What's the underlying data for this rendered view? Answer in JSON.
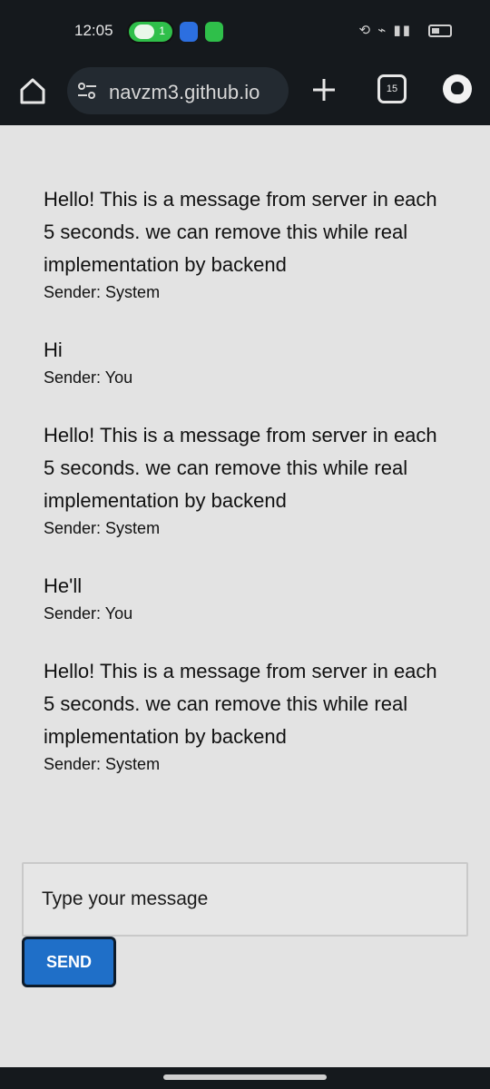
{
  "status_bar": {
    "time": "12:05",
    "notification_badge": "1",
    "tabs_count": "15"
  },
  "browser": {
    "url": "navzm3.github.io",
    "icons": [
      "home-icon",
      "site-settings-icon",
      "plus-icon",
      "tabs-icon",
      "profile-icon"
    ]
  },
  "chat": {
    "messages": [
      {
        "text": "Hello! This is a message from server in each 5 seconds. we can remove this while real implementation by backend",
        "sender": "Sender: System"
      },
      {
        "text": "Hi",
        "sender": "Sender: You"
      },
      {
        "text": "Hello! This is a message from server in each 5 seconds. we can remove this while real implementation by backend",
        "sender": "Sender: System"
      },
      {
        "text": "He'll",
        "sender": "Sender: You"
      },
      {
        "text": "Hello! This is a message from server in each 5 seconds. we can remove this while real implementation by backend",
        "sender": "Sender: System"
      }
    ],
    "input": {
      "placeholder": "Type your message",
      "value": ""
    },
    "send_label": "SEND"
  },
  "colors": {
    "send_button": "#1f6fc8",
    "page_bg": "#e3e3e3",
    "chrome_bg": "#15191d"
  }
}
